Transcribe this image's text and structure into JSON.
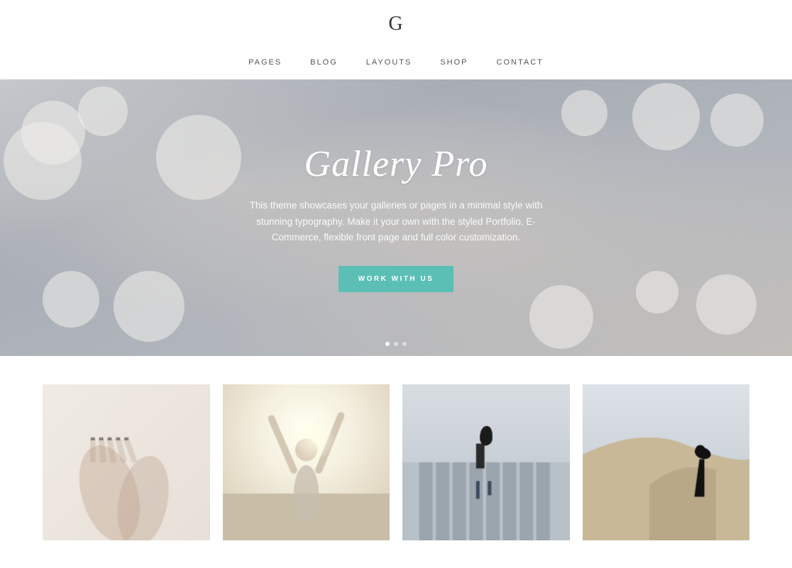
{
  "header": {
    "logo": "G",
    "nav": {
      "items": [
        "PAGES",
        "BLOG",
        "LAYOUTS",
        "SHOP",
        "CONTACT"
      ]
    }
  },
  "hero": {
    "title": "Gallery Pro",
    "description": "This theme showcases your galleries or pages in a minimal style with stunning typography. Make it your own with the styled Portfolio, E-Commerce, flexible front page and full color customization.",
    "cta_label": "WORK WITH US",
    "dots": [
      true,
      false,
      false
    ]
  },
  "gallery": {
    "items": [
      {
        "id": "hands",
        "alt": "Hands photo"
      },
      {
        "id": "woman-arms-raised",
        "alt": "Woman raising arms"
      },
      {
        "id": "woman-walking",
        "alt": "Woman walking on dock"
      },
      {
        "id": "desert-landscape",
        "alt": "Desert landscape"
      }
    ]
  },
  "colors": {
    "accent": "#5bbfb5",
    "nav_text": "#555555",
    "hero_overlay": "#b8bfc8"
  }
}
